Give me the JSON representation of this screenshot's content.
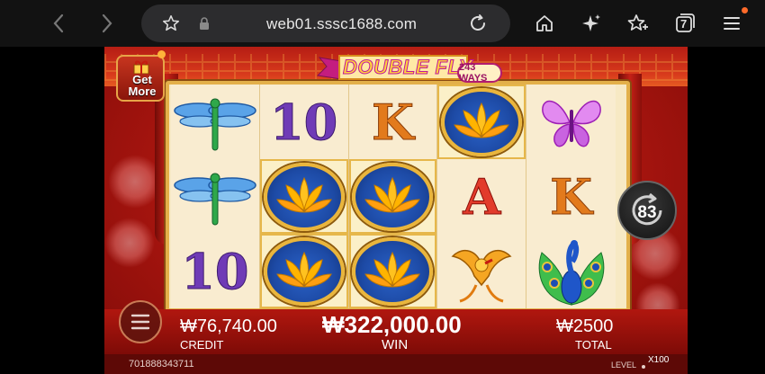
{
  "browser": {
    "back_icon": "chevron-left-icon",
    "forward_icon": "chevron-right-icon",
    "url": "web01.sssc1688.com",
    "tab_count": "7",
    "notification_color": "#ff6a2a"
  },
  "game": {
    "title": "DOUBLE FLY",
    "ways": "243 WAYS",
    "get_more": "Get\nMore",
    "autospin_count": "83",
    "credit_value": "₩76,740.00",
    "credit_label": "CREDIT",
    "win_value": "₩322,000.00",
    "win_label": "WIN",
    "total_value": "₩2500",
    "total_label": "TOTAL",
    "serial": "701888343711",
    "level_label": "LEVEL",
    "level_value": "X100",
    "reels": [
      [
        "dragonfly",
        "dragonfly",
        "10"
      ],
      [
        "10",
        "lotus",
        "lotus"
      ],
      [
        "K",
        "lotus",
        "lotus"
      ],
      [
        "lotus",
        "A",
        "phoenix"
      ],
      [
        "butterfly",
        "K",
        "peacock"
      ]
    ],
    "colors": {
      "frame_gold": "#e3b04a",
      "background_red": "#a8150f",
      "lotus_blue": "#1d4aa5"
    }
  }
}
